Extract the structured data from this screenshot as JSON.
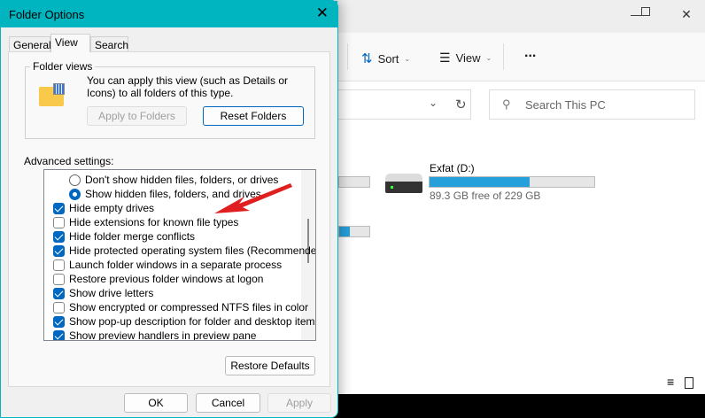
{
  "explorer": {
    "toolbar": {
      "sort": "Sort",
      "view": "View",
      "more": "..."
    },
    "search_placeholder": "Search This PC",
    "drive": {
      "name": "Exfat (D:)",
      "free_text": "89.3 GB free of 229 GB",
      "used_percent": 61
    },
    "partial_bars": [
      {
        "used_percent": 0
      },
      {
        "used_percent": 35
      }
    ]
  },
  "dialog": {
    "title": "Folder Options",
    "tabs": [
      "General",
      "View",
      "Search"
    ],
    "active_tab": "View",
    "folder_views": {
      "label": "Folder views",
      "description": "You can apply this view (such as Details or Icons) to all folders of this type.",
      "apply_button": "Apply to Folders",
      "reset_button": "Reset Folders"
    },
    "advanced_label": "Advanced settings:",
    "items": [
      {
        "type": "radio",
        "label": "Don't show hidden files, folders, or drives",
        "checked": false
      },
      {
        "type": "radio",
        "label": "Show hidden files, folders, and drives",
        "checked": true
      },
      {
        "type": "check",
        "label": "Hide empty drives",
        "checked": true
      },
      {
        "type": "check",
        "label": "Hide extensions for known file types",
        "checked": false
      },
      {
        "type": "check",
        "label": "Hide folder merge conflicts",
        "checked": true
      },
      {
        "type": "check",
        "label": "Hide protected operating system files (Recommended)",
        "checked": true
      },
      {
        "type": "check",
        "label": "Launch folder windows in a separate process",
        "checked": false
      },
      {
        "type": "check",
        "label": "Restore previous folder windows at logon",
        "checked": false
      },
      {
        "type": "check",
        "label": "Show drive letters",
        "checked": true
      },
      {
        "type": "check",
        "label": "Show encrypted or compressed NTFS files in color",
        "checked": false
      },
      {
        "type": "check",
        "label": "Show pop-up description for folder and desktop items",
        "checked": true
      },
      {
        "type": "check",
        "label": "Show preview handlers in preview pane",
        "checked": true
      }
    ],
    "restore_defaults": "Restore Defaults",
    "ok": "OK",
    "cancel": "Cancel",
    "apply": "Apply"
  },
  "colors": {
    "title_bar": "#00b4c0",
    "accent": "#0067c0",
    "progress": "#26a0da",
    "annotation_arrow": "#e02020"
  }
}
